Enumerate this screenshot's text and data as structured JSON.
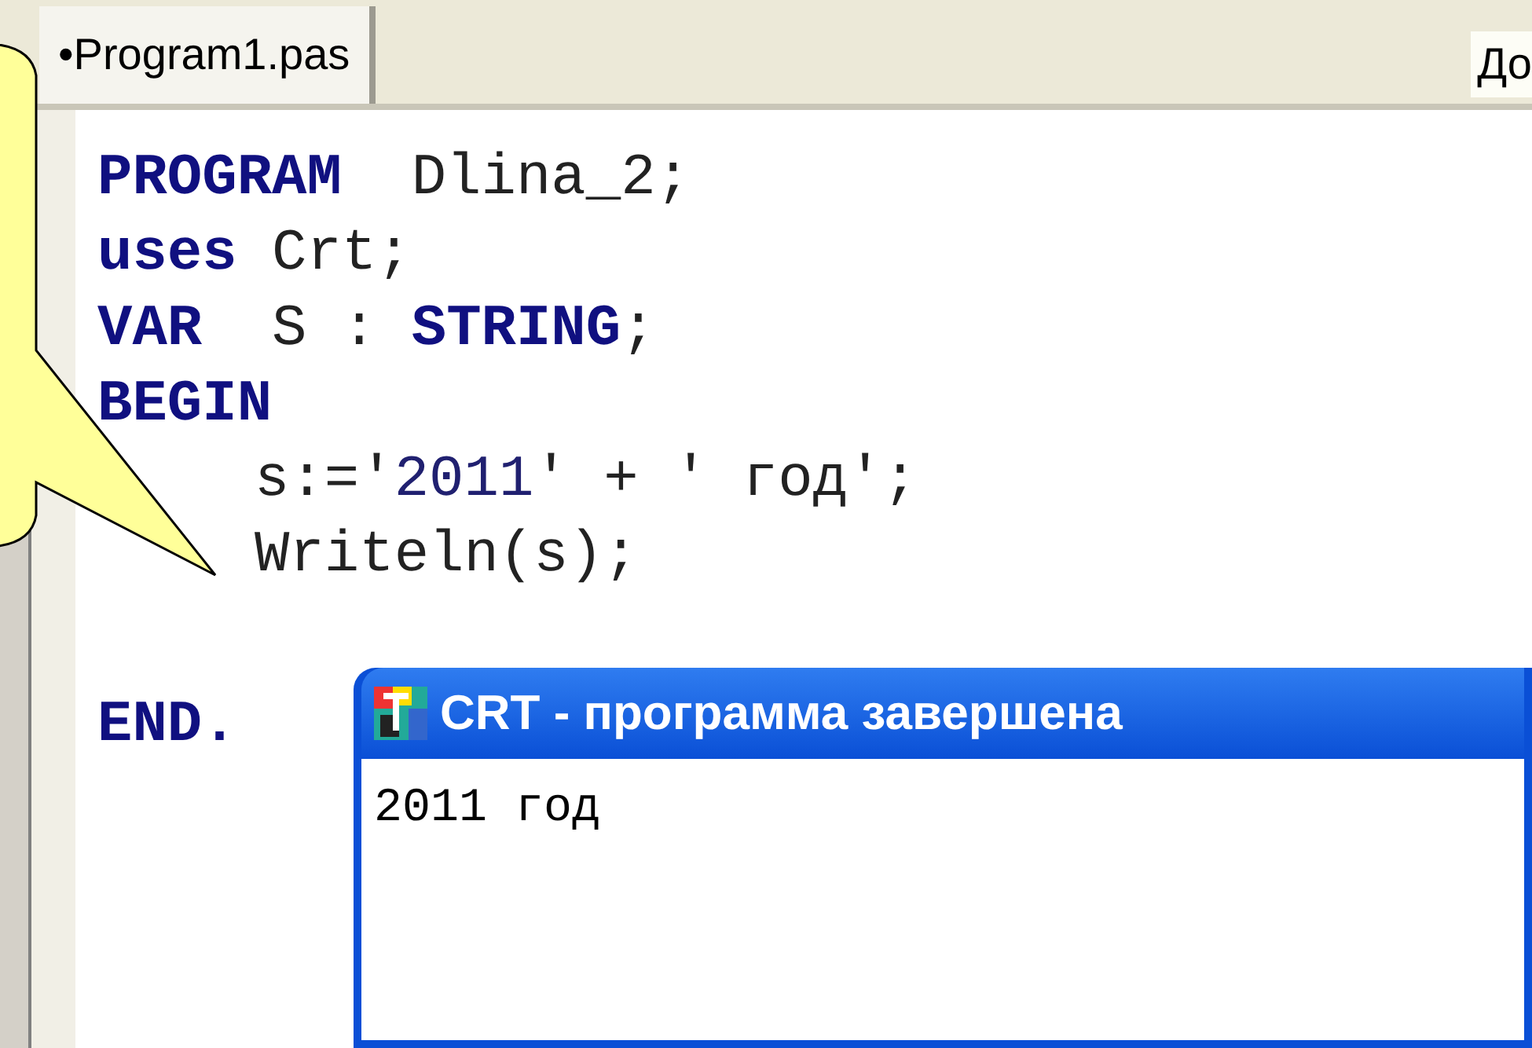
{
  "tabs": [
    {
      "label": "•Program1.pas",
      "selected": true
    }
  ],
  "right_label": "До",
  "code_blocks": [
    {
      "lines": [
        {
          "tokens": [
            {
              "text": "PROGRAM",
              "kind": "keyword"
            },
            {
              "text": "  Dlina_2;",
              "kind": "plain"
            }
          ]
        },
        {
          "tokens": [
            {
              "text": "uses",
              "kind": "keyword"
            },
            {
              "text": " Crt;",
              "kind": "plain"
            }
          ]
        },
        {
          "tokens": [
            {
              "text": "VAR",
              "kind": "keyword"
            },
            {
              "text": "  S : ",
              "kind": "plain"
            },
            {
              "text": "STRING",
              "kind": "keyword"
            },
            {
              "text": ";",
              "kind": "plain"
            }
          ]
        },
        {
          "tokens": [
            {
              "text": "BEGIN",
              "kind": "keyword"
            }
          ],
          "children": [
            {
              "tokens": [
                {
                  "text": "s:='",
                  "kind": "plain"
                },
                {
                  "text": "2011",
                  "kind": "number"
                },
                {
                  "text": "' + ' год';",
                  "kind": "plain"
                }
              ]
            },
            {
              "tokens": [
                {
                  "text": "Writeln(s);",
                  "kind": "plain"
                }
              ]
            }
          ]
        }
      ]
    },
    {
      "lines": [
        {
          "tokens": [
            {
              "text": "END.",
              "kind": "keyword"
            }
          ]
        }
      ]
    }
  ],
  "output_window": {
    "title": "CRT - программа завершена",
    "output": "2011 год"
  }
}
